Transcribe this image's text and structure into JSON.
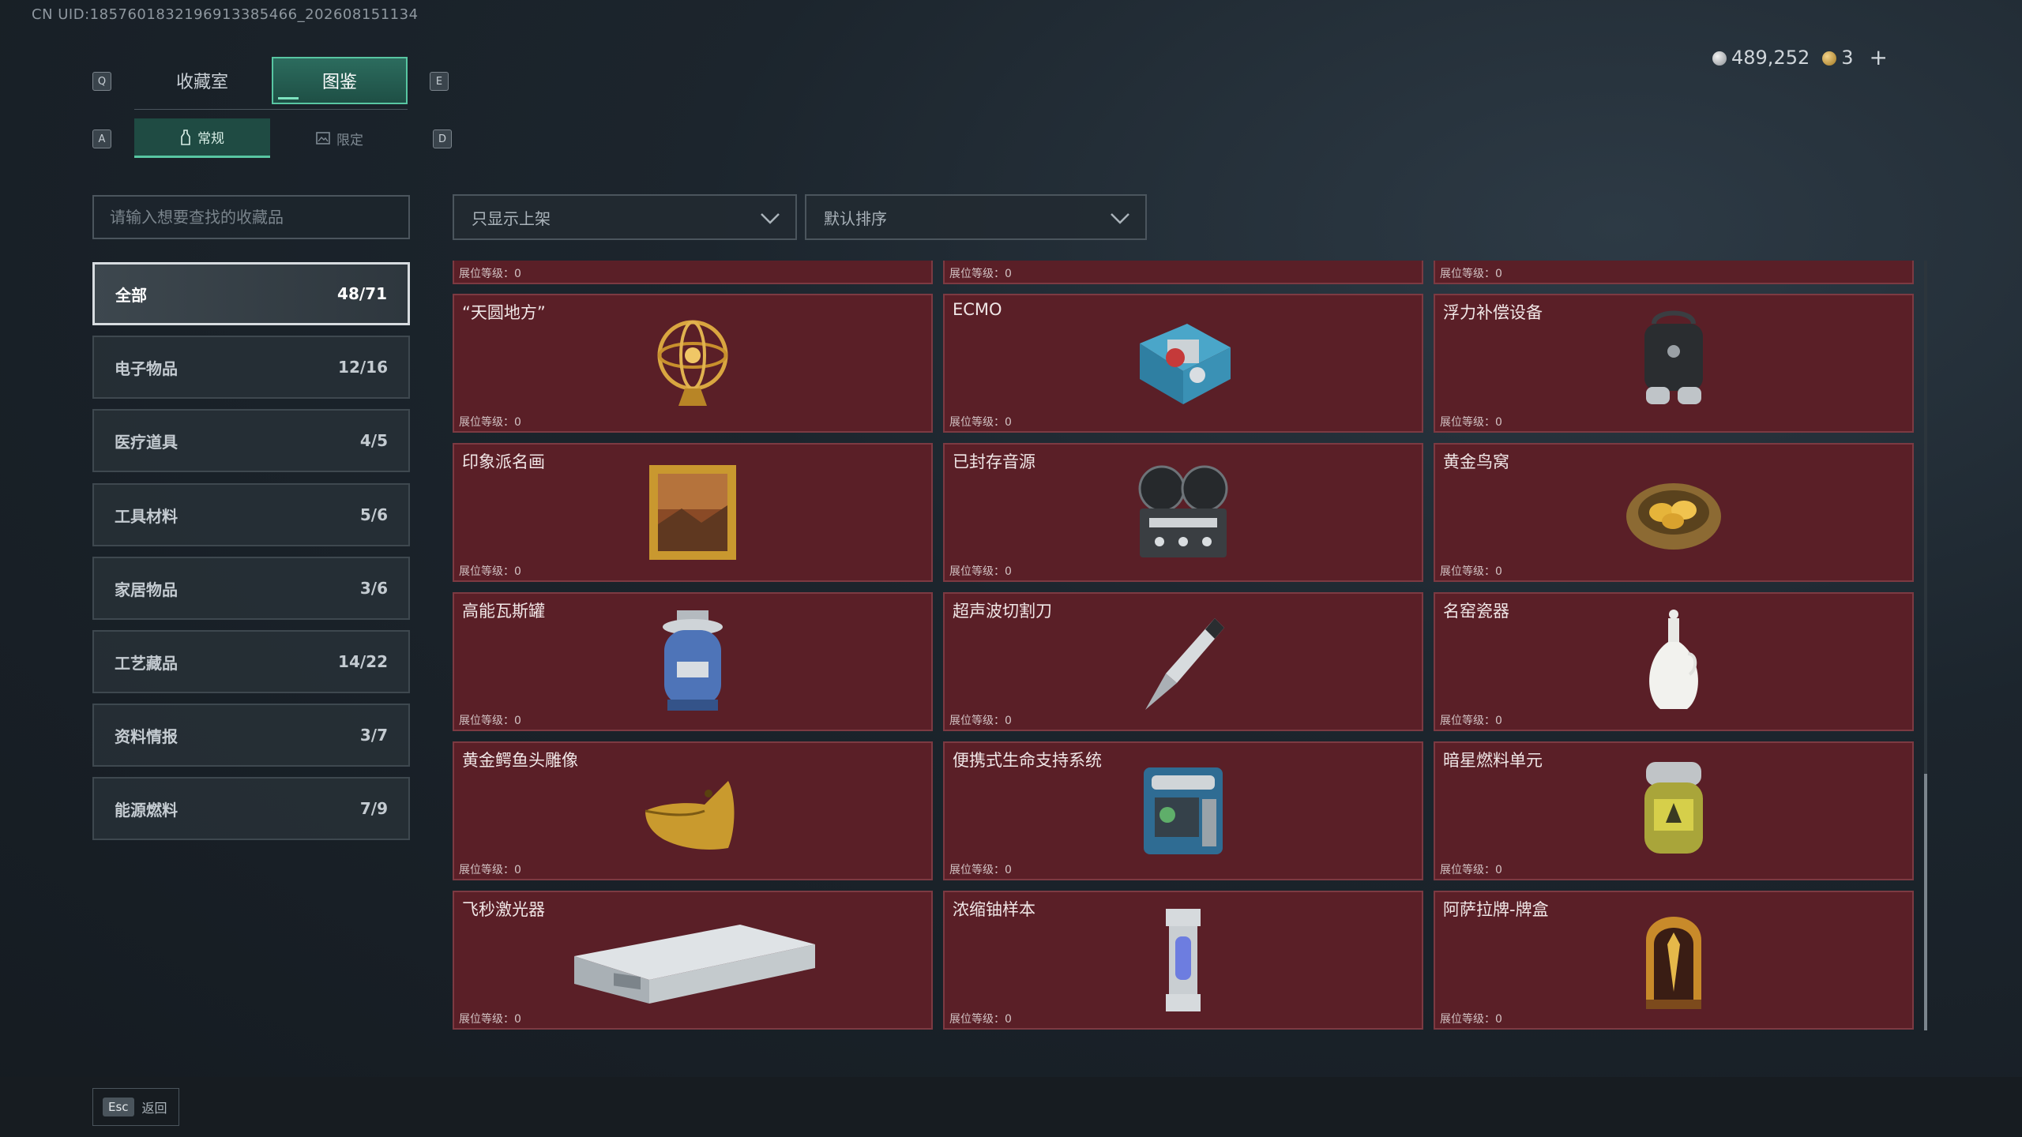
{
  "uid": "CN UID:1857601832196913385466_202608151134",
  "currency": {
    "silver": "489,252",
    "gold": "3",
    "add_label": "+"
  },
  "keys": {
    "q": "Q",
    "e": "E",
    "a": "A",
    "d": "D",
    "esc": "Esc"
  },
  "main_tabs": [
    {
      "label": "收藏室",
      "active": false
    },
    {
      "label": "图鉴",
      "active": true
    }
  ],
  "sub_tabs": [
    {
      "label": "常规",
      "active": true
    },
    {
      "label": "限定",
      "active": false
    }
  ],
  "search": {
    "placeholder": "请输入想要查找的收藏品"
  },
  "filters": {
    "shelf": "只显示上架",
    "sort": "默认排序"
  },
  "categories": [
    {
      "label": "全部",
      "count": "48/71",
      "active": true
    },
    {
      "label": "电子物品",
      "count": "12/16"
    },
    {
      "label": "医疗道具",
      "count": "4/5"
    },
    {
      "label": "工具材料",
      "count": "5/6"
    },
    {
      "label": "家居物品",
      "count": "3/6"
    },
    {
      "label": "工艺藏品",
      "count": "14/22"
    },
    {
      "label": "资料情报",
      "count": "3/7"
    },
    {
      "label": "能源燃料",
      "count": "7/9"
    }
  ],
  "partial_row_level": "展位等级：0",
  "items": [
    {
      "name": "“天圆地方”",
      "level": "展位等级：0",
      "icon": "armillary-sphere-icon"
    },
    {
      "name": "ECMO",
      "level": "展位等级：0",
      "icon": "ecmo-machine-icon"
    },
    {
      "name": "浮力补偿设备",
      "level": "展位等级：0",
      "icon": "bcd-backpack-icon"
    },
    {
      "name": "印象派名画",
      "level": "展位等级：0",
      "icon": "framed-painting-icon"
    },
    {
      "name": "已封存音源",
      "level": "展位等级：0",
      "icon": "reel-tape-recorder-icon"
    },
    {
      "name": "黄金鸟窝",
      "level": "展位等级：0",
      "icon": "golden-nest-icon"
    },
    {
      "name": "高能瓦斯罐",
      "level": "展位等级：0",
      "icon": "gas-canister-icon"
    },
    {
      "name": "超声波切割刀",
      "level": "展位等级：0",
      "icon": "ultrasonic-cutter-icon"
    },
    {
      "name": "名窑瓷器",
      "level": "展位等级：0",
      "icon": "porcelain-vase-icon"
    },
    {
      "name": "黄金鳄鱼头雕像",
      "level": "展位等级：0",
      "icon": "golden-crocodile-icon"
    },
    {
      "name": "便携式生命支持系统",
      "level": "展位等级：0",
      "icon": "life-support-icon"
    },
    {
      "name": "暗星燃料单元",
      "level": "展位等级：0",
      "icon": "fuel-cell-icon"
    },
    {
      "name": "飞秒激光器",
      "level": "展位等级：0",
      "icon": "femtosecond-laser-icon"
    },
    {
      "name": "浓缩铀样本",
      "level": "展位等级：0",
      "icon": "uranium-sample-icon"
    },
    {
      "name": "阿萨拉牌-牌盒",
      "level": "展位等级：0",
      "icon": "card-box-icon"
    }
  ],
  "back_label": "返回"
}
